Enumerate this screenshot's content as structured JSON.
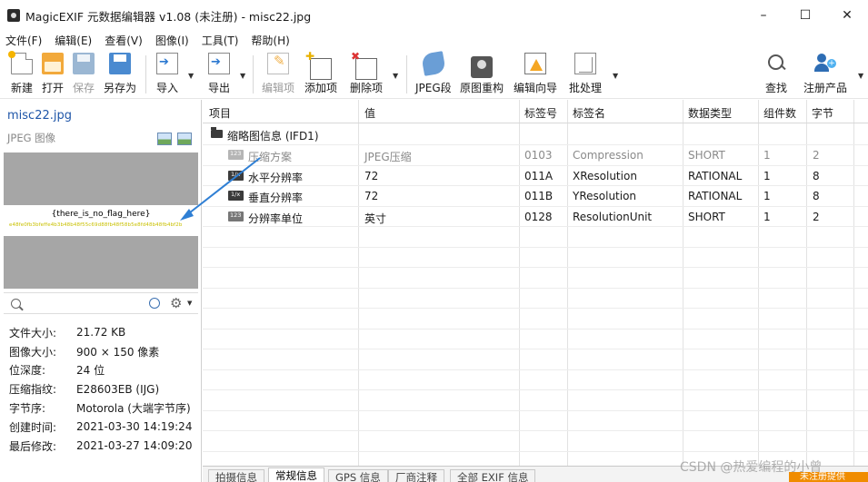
{
  "window": {
    "title": "MagicEXIF 元数据编辑器 v1.08 (未注册) - misc22.jpg",
    "min_glyph": "–",
    "max_glyph": "☐",
    "close_glyph": "✕"
  },
  "menu": [
    "文件(F)",
    "编辑(E)",
    "查看(V)",
    "图像(I)",
    "工具(T)",
    "帮助(H)"
  ],
  "toolbar": {
    "new": "新建",
    "open": "打开",
    "save": "保存",
    "saveas": "另存为",
    "import": "导入",
    "export": "导出",
    "edit_item": "编辑项",
    "add_item": "添加项",
    "delete_item": "删除项",
    "jpeg_segment": "JPEG段",
    "rebuild_original": "原图重构",
    "edit_wizard": "编辑向导",
    "batch": "批处理",
    "find": "查找",
    "register": "注册产品"
  },
  "left": {
    "filename": "misc22.jpg",
    "file_type": "JPEG 图像",
    "preview_text": "{there_is_no_flag_here}",
    "preview_subtext": "e48fe0fb3bfeffe4b3b48b48f55c69d88fb48f58b5e8fd48b48fb4bf2b",
    "info": [
      {
        "key": "文件大小:",
        "value": "21.72 KB"
      },
      {
        "key": "图像大小:",
        "value": "900 × 150 像素"
      },
      {
        "key": "位深度:",
        "value": "24 位"
      },
      {
        "key": "压缩指纹:",
        "value": "E28603EB (IJG)"
      },
      {
        "key": "字节序:",
        "value": "Motorola (大端字节序)"
      },
      {
        "key": "创建时间:",
        "value": "2021-03-30 14:19:24"
      },
      {
        "key": "最后修改:",
        "value": "2021-03-27 14:09:20"
      }
    ]
  },
  "table": {
    "headers": [
      "项目",
      "值",
      "标签号",
      "标签名",
      "数据类型",
      "组件数",
      "字节"
    ],
    "group": "缩略图信息 (IFD1)",
    "rows": [
      {
        "item": "压缩方案",
        "value": "JPEG压缩",
        "tag": "0103",
        "name": "Compression",
        "type": "SHORT",
        "count": "1",
        "bytes": "2"
      },
      {
        "item": "水平分辨率",
        "value": "72",
        "tag": "011A",
        "name": "XResolution",
        "type": "RATIONAL",
        "count": "1",
        "bytes": "8"
      },
      {
        "item": "垂直分辨率",
        "value": "72",
        "tag": "011B",
        "name": "YResolution",
        "type": "RATIONAL",
        "count": "1",
        "bytes": "8"
      },
      {
        "item": "分辨率单位",
        "value": "英寸",
        "tag": "0128",
        "name": "ResolutionUnit",
        "type": "SHORT",
        "count": "1",
        "bytes": "2"
      }
    ]
  },
  "tabs": [
    "拍摄信息",
    "常规信息",
    "GPS 信息",
    "厂商注释",
    "全部 EXIF 信息"
  ],
  "watermark": "CSDN @热爱编程的小曾",
  "badge": "未注册提供"
}
